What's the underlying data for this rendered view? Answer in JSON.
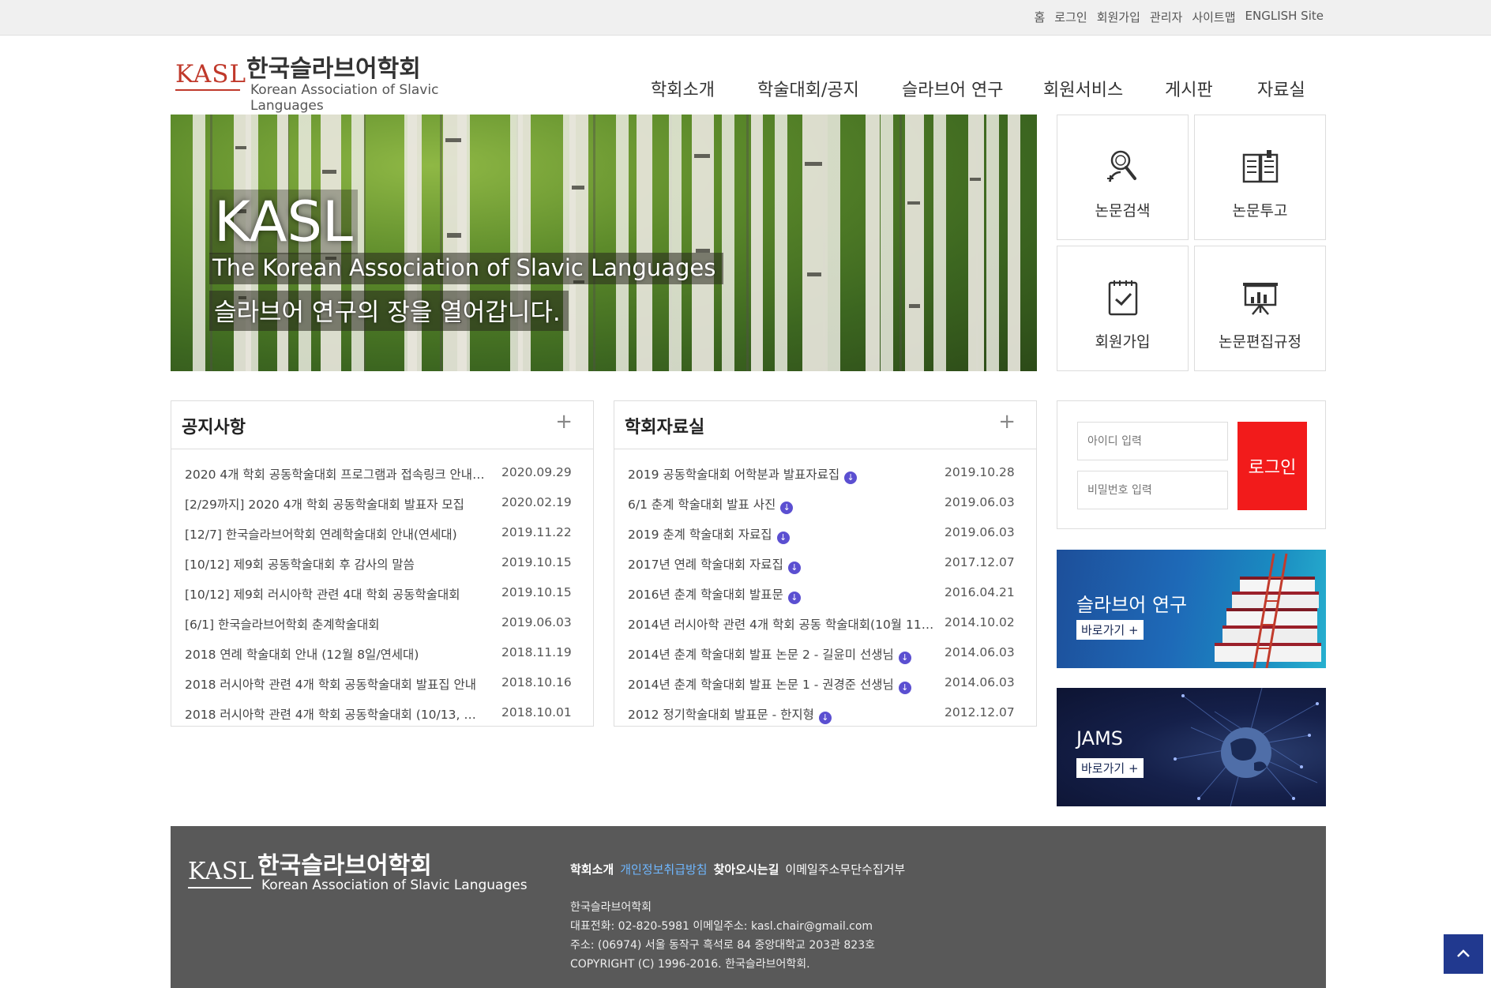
{
  "top_links": [
    "홈",
    "로그인",
    "회원가입",
    "관리자",
    "사이트맵",
    "ENGLISH Site"
  ],
  "logo": {
    "abbr": "KASL",
    "name_ko": "한국슬라브어학회",
    "name_en": "Korean Association of Slavic Languages"
  },
  "nav": [
    "학회소개",
    "학술대회/공지",
    "슬라브어 연구",
    "회원서비스",
    "게시판",
    "자료실"
  ],
  "hero": {
    "title": "KASL",
    "subtitle": "The Korean Association of Slavic Languages",
    "slogan": "슬라브어 연구의 장을 열어갑니다."
  },
  "quick_menu": [
    {
      "label": "논문검색",
      "icon": "search-person-icon"
    },
    {
      "label": "논문투고",
      "icon": "open-book-icon"
    },
    {
      "label": "회원가입",
      "icon": "clipboard-check-icon"
    },
    {
      "label": "논문편집규정",
      "icon": "presentation-board-icon"
    }
  ],
  "notices": {
    "title": "공지사항",
    "more": "+",
    "items": [
      {
        "title": "2020 4개 학회 공동학술대회 프로그램과 접속링크 안내 (1...",
        "date": "2020.09.29"
      },
      {
        "title": "[2/29까지] 2020 4개 학회 공동학술대회 발표자 모집",
        "date": "2020.02.19"
      },
      {
        "title": "[12/7] 한국슬라브어학회 연례학술대회 안내(연세대)",
        "date": "2019.11.22"
      },
      {
        "title": "[10/12] 제9회 공동학술대회 후 감사의 말씀",
        "date": "2019.10.15"
      },
      {
        "title": "[10/12] 제9회 러시아학 관련 4대 학회 공동학술대회",
        "date": "2019.10.15"
      },
      {
        "title": "[6/1] 한국슬라브어학회 춘계학술대회",
        "date": "2019.06.03"
      },
      {
        "title": "2018 연례 학술대회 안내 (12월 8일/연세대)",
        "date": "2018.11.19"
      },
      {
        "title": "2018 러시아학 관련 4개 학회 공동학술대회 발표집 안내",
        "date": "2018.10.16"
      },
      {
        "title": "2018 러시아학 관련 4개 학회 공동학술대회 (10/13, 연세...",
        "date": "2018.10.01"
      }
    ]
  },
  "archive": {
    "title": "학회자료실",
    "more": "+",
    "items": [
      {
        "title": "2019 공동학술대회 어학분과 발표자료집",
        "date": "2019.10.28"
      },
      {
        "title": "6/1 춘계 학술대회 발표 사진",
        "date": "2019.06.03"
      },
      {
        "title": "2019 춘계 학술대회 자료집",
        "date": "2019.06.03"
      },
      {
        "title": "2017년 연례 학술대회 자료집",
        "date": "2017.12.07"
      },
      {
        "title": "2016년 춘계 학술대회 발표문",
        "date": "2016.04.21"
      },
      {
        "title": "2014년 러시아학 관련 4개 학회 공동 학술대회(10월 11일...",
        "date": "2014.10.02"
      },
      {
        "title": "2014년 춘계 학술대회 발표 논문 2 - 길윤미 선생님",
        "date": "2014.06.03"
      },
      {
        "title": "2014년 춘계 학술대회 발표 논문 1 - 권경준 선생님",
        "date": "2014.06.03"
      },
      {
        "title": "2012 정기학술대회 발표문 - 한지형",
        "date": "2012.12.07"
      }
    ]
  },
  "login": {
    "id_placeholder": "아이디 입력",
    "pw_placeholder": "비밀번호 입력",
    "button": "로그인"
  },
  "banners": [
    {
      "title": "슬라브어 연구",
      "link": "바로가기 +"
    },
    {
      "title": "JAMS",
      "link": "바로가기 +"
    }
  ],
  "footer": {
    "links": [
      "학회소개",
      "개인정보취급방침",
      "찾아오시는길",
      "이메일주소무단수집거부"
    ],
    "org": "한국슬라브어학회",
    "contact": "대표전화: 02-820-5981 이메일주소: kasl.chair@gmail.com",
    "address": "주소: (06974) 서울 동작구 흑석로 84 중앙대학교 203관 823호",
    "copyright": "COPYRIGHT (C) 1996-2016. 한국슬라브어학회."
  },
  "colors": {
    "accent_red": "#f21b1b",
    "logo_red": "#c0392b",
    "footer_bg": "#595959",
    "link_blue": "#6fb7ff",
    "download_icon": "#5b4fd1",
    "to_top": "#21398f"
  }
}
